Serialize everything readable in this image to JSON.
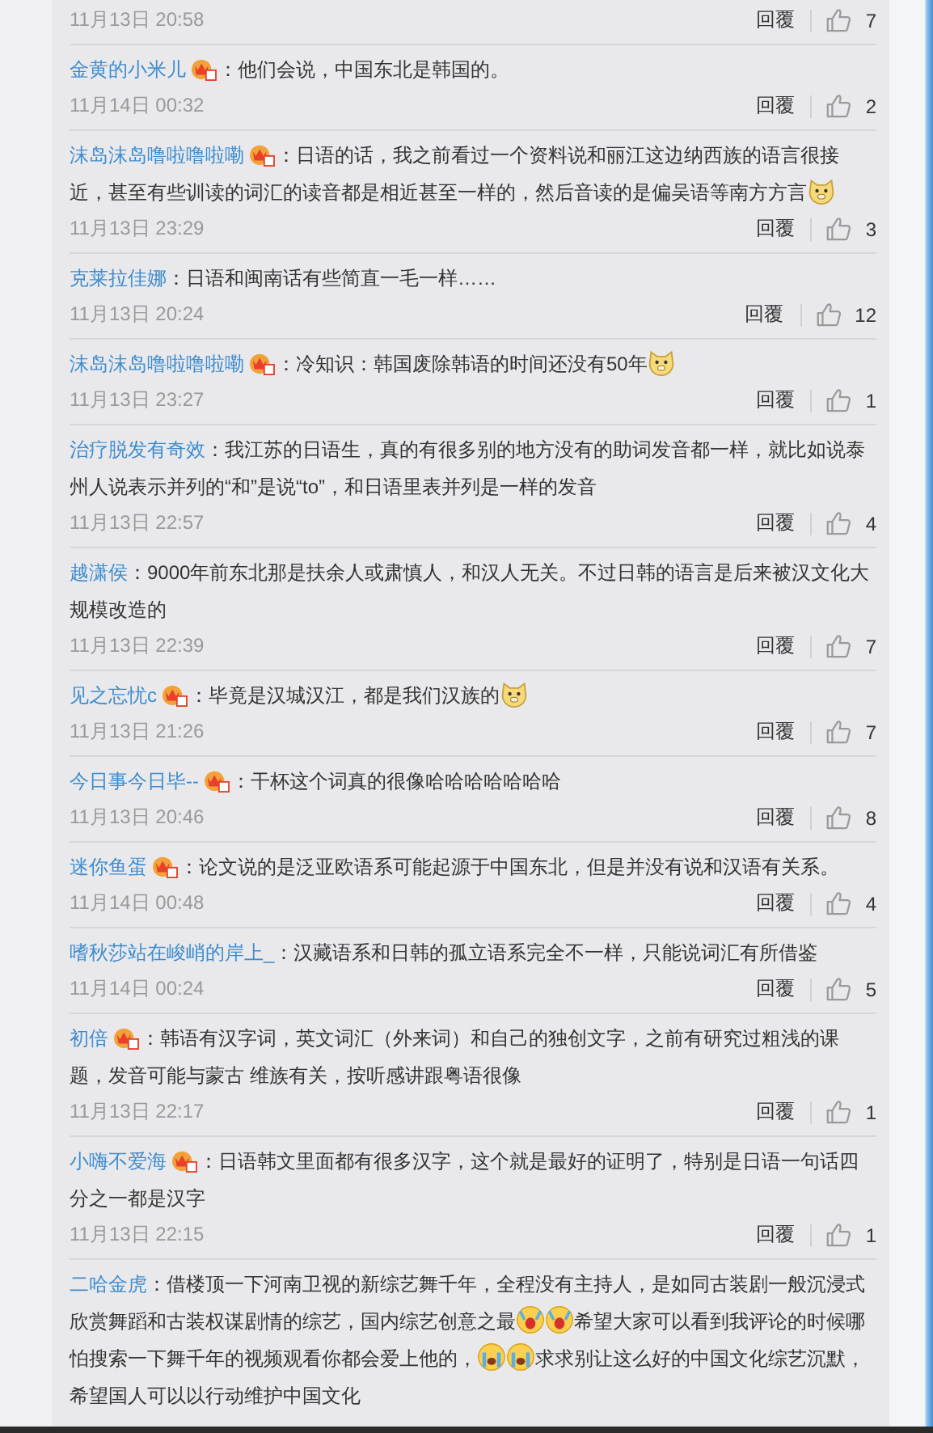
{
  "comments": [
    {
      "time": "11月13日 20:58",
      "reply": "回覆",
      "likes": "7"
    },
    {
      "name": "金黄的小米儿",
      "member_badge": true,
      "content": [
        {
          "kind": "text",
          "text": "：他们会说，中国东北是韩国的。"
        }
      ],
      "time": "11月14日 00:32",
      "reply": "回覆",
      "likes": "2"
    },
    {
      "name": "沫岛沫岛噜啦噜啦嘞",
      "member_badge": true,
      "content": [
        {
          "kind": "text",
          "text": "：日语的话，我之前看过一个资料说和丽江这边纳西族的语言很接近，甚至有些训读的词汇的读音都是相近甚至一样的，然后音读的是偏吴语等南方方言"
        },
        {
          "kind": "dog"
        }
      ],
      "time": "11月13日 23:29",
      "reply": "回覆",
      "likes": "3"
    },
    {
      "name": "克莱拉佳娜",
      "member_badge": false,
      "content": [
        {
          "kind": "text",
          "text": "：日语和闽南话有些简直一毛一样……"
        }
      ],
      "time": "11月13日 20:24",
      "reply": "回覆",
      "likes": "12"
    },
    {
      "name": "沫岛沫岛噜啦噜啦嘞",
      "member_badge": true,
      "content": [
        {
          "kind": "text",
          "text": "：冷知识：韩国废除韩语的时间还没有50年"
        },
        {
          "kind": "dog"
        }
      ],
      "time": "11月13日 23:27",
      "reply": "回覆",
      "likes": "1"
    },
    {
      "name": "治疗脱发有奇效",
      "member_badge": false,
      "content": [
        {
          "kind": "text",
          "text": "：我江苏的日语生，真的有很多别的地方没有的助词发音都一样，就比如说泰州人说表示并列的“和”是说“to”，和日语里表并列是一样的发音"
        }
      ],
      "time": "11月13日 22:57",
      "reply": "回覆",
      "likes": "4"
    },
    {
      "name": "越潇侯",
      "member_badge": false,
      "content": [
        {
          "kind": "text",
          "text": "：9000年前东北那是扶余人或肃慎人，和汉人无关。不过日韩的语言是后来被汉文化大规模改造的"
        }
      ],
      "time": "11月13日 22:39",
      "reply": "回覆",
      "likes": "7"
    },
    {
      "name": "见之忘忧c",
      "member_badge": true,
      "content": [
        {
          "kind": "text",
          "text": "：毕竟是汉城汉江，都是我们汉族的"
        },
        {
          "kind": "dog"
        }
      ],
      "time": "11月13日 21:26",
      "reply": "回覆",
      "likes": "7"
    },
    {
      "name": "今日事今日毕--",
      "member_badge": true,
      "content": [
        {
          "kind": "text",
          "text": "：干杯这个词真的很像哈哈哈哈哈哈哈"
        }
      ],
      "time": "11月13日 20:46",
      "reply": "回覆",
      "likes": "8"
    },
    {
      "name": "迷你鱼蛋",
      "member_badge": true,
      "content": [
        {
          "kind": "text",
          "text": "：论文说的是泛亚欧语系可能起源于中国东北，但是并没有说和汉语有关系。"
        }
      ],
      "time": "11月14日 00:48",
      "reply": "回覆",
      "likes": "4"
    },
    {
      "name": "嗜秋莎站在峻峭的岸上_",
      "member_badge": false,
      "content": [
        {
          "kind": "text",
          "text": "：汉藏语系和日韩的孤立语系完全不一样，只能说词汇有所借鉴"
        }
      ],
      "time": "11月14日 00:24",
      "reply": "回覆",
      "likes": "5"
    },
    {
      "name": "初倍",
      "member_badge": true,
      "content": [
        {
          "kind": "text",
          "text": "：韩语有汉字词，英文词汇（外来词）和自己的独创文字，之前有研究过粗浅的课题，发音可能与蒙古 维族有关，按听感讲跟粤语很像"
        }
      ],
      "time": "11月13日 22:17",
      "reply": "回覆",
      "likes": "1"
    },
    {
      "name": "小嗨不爱海",
      "member_badge": true,
      "content": [
        {
          "kind": "text",
          "text": "：日语韩文里面都有很多汉字，这个就是最好的证明了，特别是日语一句话四分之一都是汉字"
        }
      ],
      "time": "11月13日 22:15",
      "reply": "回覆",
      "likes": "1"
    },
    {
      "name": "二哈金虎",
      "member_badge": false,
      "content": [
        {
          "kind": "text",
          "text": "：借楼顶一下河南卫视的新综艺舞千年，全程没有主持人，是如同古装剧一般沉浸式欣赏舞蹈和古装权谋剧情的综艺，国内综艺创意之最"
        },
        {
          "kind": "shock"
        },
        {
          "kind": "shock"
        },
        {
          "kind": "text",
          "text": "希望大家可以看到我评论的时候哪怕搜索一下舞千年的视频观看你都会爱上他的，"
        },
        {
          "kind": "cry"
        },
        {
          "kind": "cry"
        },
        {
          "kind": "text",
          "text": "求求别让这么好的中国文化综艺沉默，希望国人可以以行动维护中国文化"
        }
      ]
    }
  ]
}
